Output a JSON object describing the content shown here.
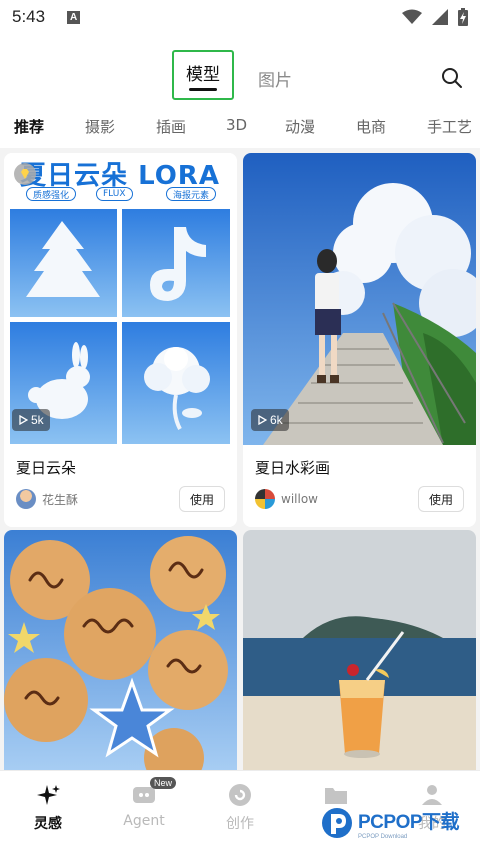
{
  "status_bar": {
    "time": "5:43",
    "notif_letter": "A"
  },
  "header": {
    "tabs": [
      {
        "label": "模型",
        "active": true
      },
      {
        "label": "图片",
        "active": false
      }
    ]
  },
  "categories": [
    "推荐",
    "摄影",
    "插画",
    "3D",
    "动漫",
    "电商",
    "手工艺"
  ],
  "cards": [
    {
      "title": "夏日云朵",
      "author": "花生酥",
      "plays": "5k",
      "use_label": "使用",
      "poster": {
        "heading": "夏日云朵 LORA",
        "tags": [
          "质感强化",
          "FLUX",
          "海报元素"
        ]
      }
    },
    {
      "title": "夏日水彩画",
      "author": "willow",
      "plays": "6k",
      "use_label": "使用"
    }
  ],
  "bottom_nav": [
    {
      "label": "灵感",
      "icon": "sparkle-icon",
      "active": true
    },
    {
      "label": "Agent",
      "icon": "agent-icon",
      "badge": "New",
      "active": false
    },
    {
      "label": "创作",
      "icon": "create-icon",
      "active": false
    },
    {
      "label": "",
      "icon": "folder-icon",
      "active": false
    },
    {
      "label": "我的",
      "icon": "person-icon",
      "active": false
    }
  ],
  "watermark": {
    "text": "PCPOP下载",
    "sub": "PCPOP Download"
  },
  "colors": {
    "highlight": "#2fb84a",
    "brand_blue": "#1771d6"
  }
}
